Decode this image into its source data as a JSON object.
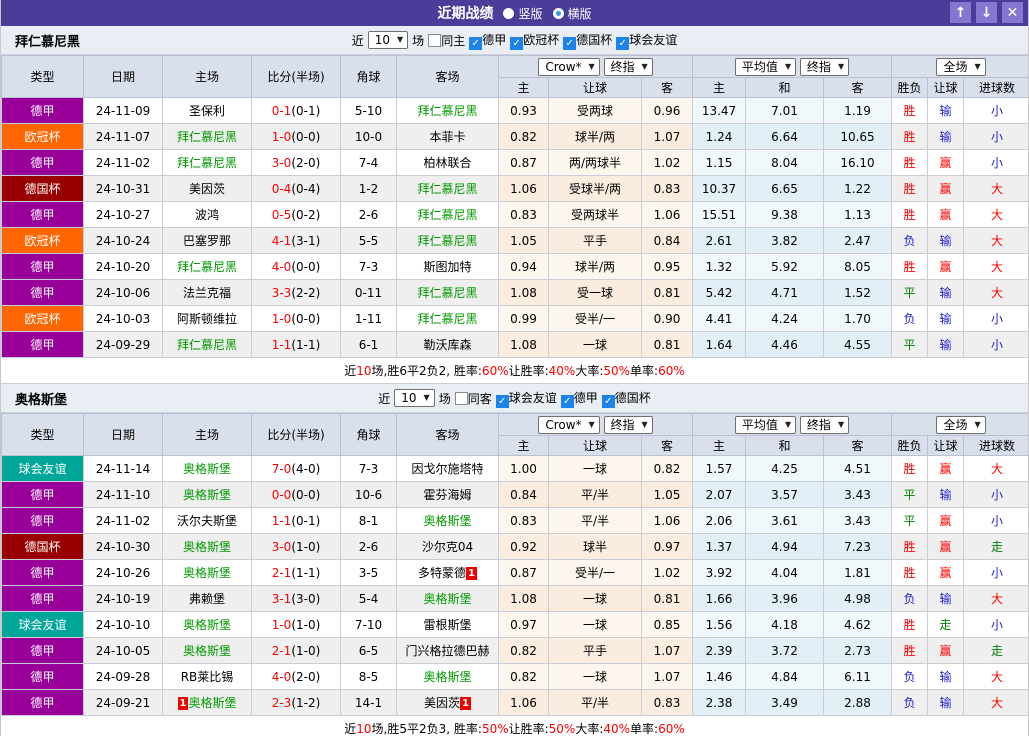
{
  "titlebar": {
    "title": "近期战绩",
    "radios": [
      {
        "label": "竖版",
        "selected": true
      },
      {
        "label": "横版",
        "selected": false
      }
    ],
    "buttons": [
      {
        "name": "move-up-button",
        "glyph": "↑"
      },
      {
        "name": "move-down-button",
        "glyph": "↓"
      },
      {
        "name": "close-button",
        "glyph": "✕"
      }
    ],
    "bar_color": "#4a3c99",
    "button_color": "#8577d0"
  },
  "league_colors": {
    "德甲": "#990099",
    "欧冠杯": "#ff6600",
    "德国杯": "#990000",
    "球会友谊": "#00a69a"
  },
  "table_header": {
    "cols": [
      "类型",
      "日期",
      "主场",
      "比分(半场)",
      "角球",
      "客场"
    ],
    "sub": [
      "主",
      "让球",
      "客",
      "主",
      "和",
      "客",
      "胜负",
      "让球",
      "进球数"
    ],
    "crow_select": "Crow*",
    "crow_type_select": "终指",
    "avg_select": "平均值",
    "avg_type_select": "终指",
    "full_select": "全场"
  },
  "result_colors": {
    "r": "#ff0000",
    "b": "#2020cc",
    "g": "#008000"
  },
  "sections": [
    {
      "team": "拜仁慕尼黑",
      "filter": {
        "near": "近",
        "count": "10",
        "games": "场",
        "same": {
          "label": "同主",
          "checked": false
        },
        "leagues": [
          {
            "label": "德甲",
            "checked": true
          },
          {
            "label": "欧冠杯",
            "checked": true
          },
          {
            "label": "德国杯",
            "checked": true
          },
          {
            "label": "球会友谊",
            "checked": true
          }
        ]
      },
      "rows": [
        {
          "league": "德甲",
          "date": "24-11-09",
          "home": {
            "name": "圣保利",
            "self": false
          },
          "score": "0-1",
          "half": "(0-1)",
          "corner": "5-10",
          "away": {
            "name": "拜仁慕尼黑",
            "self": true
          },
          "odds": [
            "0.93",
            "受两球",
            "0.96",
            "13.47",
            "7.01",
            "1.19"
          ],
          "results": [
            [
              "胜",
              "r"
            ],
            [
              "输",
              "b"
            ],
            [
              "小",
              "b"
            ]
          ]
        },
        {
          "league": "欧冠杯",
          "date": "24-11-07",
          "home": {
            "name": "拜仁慕尼黑",
            "self": true
          },
          "score": "1-0",
          "half": "(0-0)",
          "corner": "10-0",
          "away": {
            "name": "本菲卡",
            "self": false
          },
          "odds": [
            "0.82",
            "球半/两",
            "1.07",
            "1.24",
            "6.64",
            "10.65"
          ],
          "results": [
            [
              "胜",
              "r"
            ],
            [
              "输",
              "b"
            ],
            [
              "小",
              "b"
            ]
          ]
        },
        {
          "league": "德甲",
          "date": "24-11-02",
          "home": {
            "name": "拜仁慕尼黑",
            "self": true
          },
          "score": "3-0",
          "half": "(2-0)",
          "corner": "7-4",
          "away": {
            "name": "柏林联合",
            "self": false
          },
          "odds": [
            "0.87",
            "两/两球半",
            "1.02",
            "1.15",
            "8.04",
            "16.10"
          ],
          "results": [
            [
              "胜",
              "r"
            ],
            [
              "赢",
              "r"
            ],
            [
              "小",
              "b"
            ]
          ]
        },
        {
          "league": "德国杯",
          "date": "24-10-31",
          "home": {
            "name": "美因茨",
            "self": false
          },
          "score": "0-4",
          "half": "(0-4)",
          "corner": "1-2",
          "away": {
            "name": "拜仁慕尼黑",
            "self": true
          },
          "odds": [
            "1.06",
            "受球半/两",
            "0.83",
            "10.37",
            "6.65",
            "1.22"
          ],
          "results": [
            [
              "胜",
              "r"
            ],
            [
              "赢",
              "r"
            ],
            [
              "大",
              "r"
            ]
          ]
        },
        {
          "league": "德甲",
          "date": "24-10-27",
          "home": {
            "name": "波鸿",
            "self": false
          },
          "score": "0-5",
          "half": "(0-2)",
          "corner": "2-6",
          "away": {
            "name": "拜仁慕尼黑",
            "self": true
          },
          "odds": [
            "0.83",
            "受两球半",
            "1.06",
            "15.51",
            "9.38",
            "1.13"
          ],
          "results": [
            [
              "胜",
              "r"
            ],
            [
              "赢",
              "r"
            ],
            [
              "大",
              "r"
            ]
          ]
        },
        {
          "league": "欧冠杯",
          "date": "24-10-24",
          "home": {
            "name": "巴塞罗那",
            "self": false
          },
          "score": "4-1",
          "half": "(3-1)",
          "corner": "5-5",
          "away": {
            "name": "拜仁慕尼黑",
            "self": true
          },
          "odds": [
            "1.05",
            "平手",
            "0.84",
            "2.61",
            "3.82",
            "2.47"
          ],
          "results": [
            [
              "负",
              "b"
            ],
            [
              "输",
              "b"
            ],
            [
              "大",
              "r"
            ]
          ]
        },
        {
          "league": "德甲",
          "date": "24-10-20",
          "home": {
            "name": "拜仁慕尼黑",
            "self": true
          },
          "score": "4-0",
          "half": "(0-0)",
          "corner": "7-3",
          "away": {
            "name": "斯图加特",
            "self": false
          },
          "odds": [
            "0.94",
            "球半/两",
            "0.95",
            "1.32",
            "5.92",
            "8.05"
          ],
          "results": [
            [
              "胜",
              "r"
            ],
            [
              "赢",
              "r"
            ],
            [
              "大",
              "r"
            ]
          ]
        },
        {
          "league": "德甲",
          "date": "24-10-06",
          "home": {
            "name": "法兰克福",
            "self": false
          },
          "score": "3-3",
          "half": "(2-2)",
          "corner": "0-11",
          "away": {
            "name": "拜仁慕尼黑",
            "self": true
          },
          "odds": [
            "1.08",
            "受一球",
            "0.81",
            "5.42",
            "4.71",
            "1.52"
          ],
          "results": [
            [
              "平",
              "g"
            ],
            [
              "输",
              "b"
            ],
            [
              "大",
              "r"
            ]
          ]
        },
        {
          "league": "欧冠杯",
          "date": "24-10-03",
          "home": {
            "name": "阿斯顿维拉",
            "self": false
          },
          "score": "1-0",
          "half": "(0-0)",
          "corner": "1-11",
          "away": {
            "name": "拜仁慕尼黑",
            "self": true
          },
          "odds": [
            "0.99",
            "受半/一",
            "0.90",
            "4.41",
            "4.24",
            "1.70"
          ],
          "results": [
            [
              "负",
              "b"
            ],
            [
              "输",
              "b"
            ],
            [
              "小",
              "b"
            ]
          ]
        },
        {
          "league": "德甲",
          "date": "24-09-29",
          "home": {
            "name": "拜仁慕尼黑",
            "self": true
          },
          "score": "1-1",
          "half": "(1-1)",
          "corner": "6-1",
          "away": {
            "name": "勒沃库森",
            "self": false
          },
          "odds": [
            "1.08",
            "一球",
            "0.81",
            "1.64",
            "4.46",
            "4.55"
          ],
          "results": [
            [
              "平",
              "g"
            ],
            [
              "输",
              "b"
            ],
            [
              "小",
              "b"
            ]
          ]
        }
      ],
      "summary": [
        [
          "近",
          "k"
        ],
        [
          "10",
          "r"
        ],
        [
          "场,胜6平2负2, 胜率:",
          "k"
        ],
        [
          "60%",
          "r"
        ],
        [
          " 让胜率:",
          "k"
        ],
        [
          "40%",
          "r"
        ],
        [
          " 大率:",
          "k"
        ],
        [
          "50%",
          "r"
        ],
        [
          " 单率:",
          "k"
        ],
        [
          "60%",
          "r"
        ]
      ]
    },
    {
      "team": "奥格斯堡",
      "filter": {
        "near": "近",
        "count": "10",
        "games": "场",
        "same": {
          "label": "同客",
          "checked": false
        },
        "leagues": [
          {
            "label": "球会友谊",
            "checked": true
          },
          {
            "label": "德甲",
            "checked": true
          },
          {
            "label": "德国杯",
            "checked": true
          }
        ]
      },
      "rows": [
        {
          "league": "球会友谊",
          "date": "24-11-14",
          "home": {
            "name": "奥格斯堡",
            "self": true
          },
          "score": "7-0",
          "half": "(4-0)",
          "corner": "7-3",
          "away": {
            "name": "因戈尔施塔特",
            "self": false
          },
          "odds": [
            "1.00",
            "一球",
            "0.82",
            "1.57",
            "4.25",
            "4.51"
          ],
          "results": [
            [
              "胜",
              "r"
            ],
            [
              "赢",
              "r"
            ],
            [
              "大",
              "r"
            ]
          ]
        },
        {
          "league": "德甲",
          "date": "24-11-10",
          "home": {
            "name": "奥格斯堡",
            "self": true
          },
          "score": "0-0",
          "half": "(0-0)",
          "corner": "10-6",
          "away": {
            "name": "霍芬海姆",
            "self": false
          },
          "odds": [
            "0.84",
            "平/半",
            "1.05",
            "2.07",
            "3.57",
            "3.43"
          ],
          "results": [
            [
              "平",
              "g"
            ],
            [
              "输",
              "b"
            ],
            [
              "小",
              "b"
            ]
          ]
        },
        {
          "league": "德甲",
          "date": "24-11-02",
          "home": {
            "name": "沃尔夫斯堡",
            "self": false
          },
          "score": "1-1",
          "half": "(0-1)",
          "corner": "8-1",
          "away": {
            "name": "奥格斯堡",
            "self": true
          },
          "odds": [
            "0.83",
            "平/半",
            "1.06",
            "2.06",
            "3.61",
            "3.43"
          ],
          "results": [
            [
              "平",
              "g"
            ],
            [
              "赢",
              "r"
            ],
            [
              "小",
              "b"
            ]
          ]
        },
        {
          "league": "德国杯",
          "date": "24-10-30",
          "home": {
            "name": "奥格斯堡",
            "self": true
          },
          "score": "3-0",
          "half": "(1-0)",
          "corner": "2-6",
          "away": {
            "name": "沙尔克04",
            "self": false
          },
          "odds": [
            "0.92",
            "球半",
            "0.97",
            "1.37",
            "4.94",
            "7.23"
          ],
          "results": [
            [
              "胜",
              "r"
            ],
            [
              "赢",
              "r"
            ],
            [
              "走",
              "g"
            ]
          ]
        },
        {
          "league": "德甲",
          "date": "24-10-26",
          "home": {
            "name": "奥格斯堡",
            "self": true
          },
          "score": "2-1",
          "half": "(1-1)",
          "corner": "3-5",
          "away": {
            "name": "多特蒙德",
            "self": false,
            "badge": "1"
          },
          "odds": [
            "0.87",
            "受半/一",
            "1.02",
            "3.92",
            "4.04",
            "1.81"
          ],
          "results": [
            [
              "胜",
              "r"
            ],
            [
              "赢",
              "r"
            ],
            [
              "小",
              "b"
            ]
          ]
        },
        {
          "league": "德甲",
          "date": "24-10-19",
          "home": {
            "name": "弗赖堡",
            "self": false
          },
          "score": "3-1",
          "half": "(3-0)",
          "corner": "5-4",
          "away": {
            "name": "奥格斯堡",
            "self": true
          },
          "odds": [
            "1.08",
            "一球",
            "0.81",
            "1.66",
            "3.96",
            "4.98"
          ],
          "results": [
            [
              "负",
              "b"
            ],
            [
              "输",
              "b"
            ],
            [
              "大",
              "r"
            ]
          ]
        },
        {
          "league": "球会友谊",
          "date": "24-10-10",
          "home": {
            "name": "奥格斯堡",
            "self": true
          },
          "score": "1-0",
          "half": "(1-0)",
          "corner": "7-10",
          "away": {
            "name": "雷根斯堡",
            "self": false
          },
          "odds": [
            "0.97",
            "一球",
            "0.85",
            "1.56",
            "4.18",
            "4.62"
          ],
          "results": [
            [
              "胜",
              "r"
            ],
            [
              "走",
              "g"
            ],
            [
              "小",
              "b"
            ]
          ]
        },
        {
          "league": "德甲",
          "date": "24-10-05",
          "home": {
            "name": "奥格斯堡",
            "self": true
          },
          "score": "2-1",
          "half": "(1-0)",
          "corner": "6-5",
          "away": {
            "name": "门兴格拉德巴赫",
            "self": false
          },
          "odds": [
            "0.82",
            "平手",
            "1.07",
            "2.39",
            "3.72",
            "2.73"
          ],
          "results": [
            [
              "胜",
              "r"
            ],
            [
              "赢",
              "r"
            ],
            [
              "走",
              "g"
            ]
          ]
        },
        {
          "league": "德甲",
          "date": "24-09-28",
          "home": {
            "name": "RB莱比锡",
            "self": false
          },
          "score": "4-0",
          "half": "(2-0)",
          "corner": "8-5",
          "away": {
            "name": "奥格斯堡",
            "self": true
          },
          "odds": [
            "0.82",
            "一球",
            "1.07",
            "1.46",
            "4.84",
            "6.11"
          ],
          "results": [
            [
              "负",
              "b"
            ],
            [
              "输",
              "b"
            ],
            [
              "大",
              "r"
            ]
          ]
        },
        {
          "league": "德甲",
          "date": "24-09-21",
          "home": {
            "name": "奥格斯堡",
            "self": true,
            "badge": "1"
          },
          "score": "2-3",
          "half": "(1-2)",
          "corner": "14-1",
          "away": {
            "name": "美因茨",
            "self": false,
            "badge": "1"
          },
          "odds": [
            "1.06",
            "平/半",
            "0.83",
            "2.38",
            "3.49",
            "2.88"
          ],
          "results": [
            [
              "负",
              "b"
            ],
            [
              "输",
              "b"
            ],
            [
              "大",
              "r"
            ]
          ]
        }
      ],
      "summary": [
        [
          "近",
          "k"
        ],
        [
          "10",
          "r"
        ],
        [
          "场,胜5平2负3, 胜率:",
          "k"
        ],
        [
          "50%",
          "r"
        ],
        [
          " 让胜率:",
          "k"
        ],
        [
          "50%",
          "r"
        ],
        [
          " 大率:",
          "k"
        ],
        [
          "40%",
          "r"
        ],
        [
          " 单率:",
          "k"
        ],
        [
          "60%",
          "r"
        ]
      ]
    }
  ]
}
